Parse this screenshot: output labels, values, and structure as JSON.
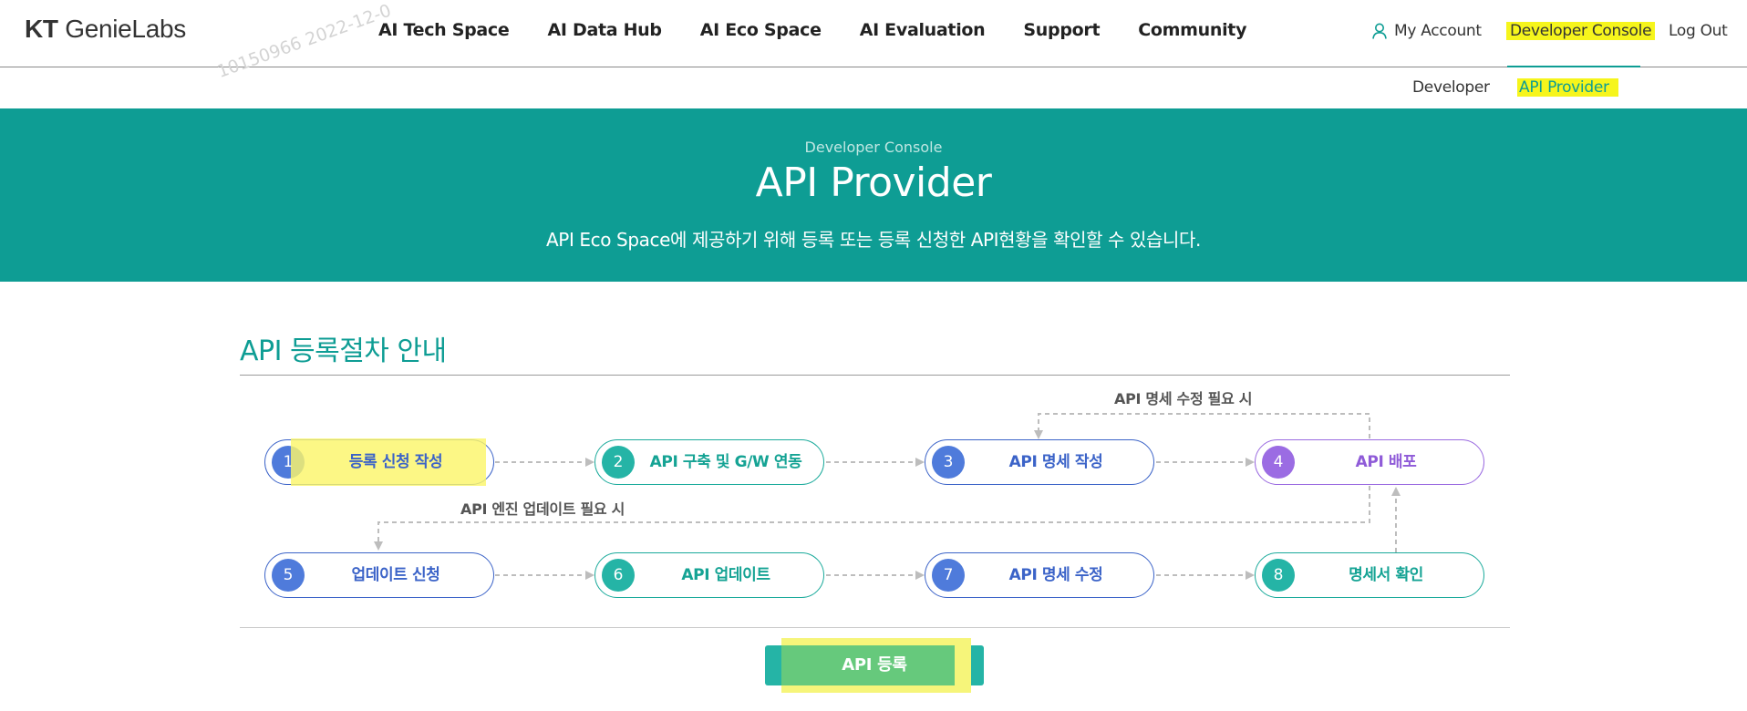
{
  "header": {
    "logo_brand": "KT",
    "logo_name": "GenieLabs",
    "nav": [
      "AI Tech Space",
      "AI Data Hub",
      "AI Eco Space",
      "AI Evaluation",
      "Support",
      "Community"
    ],
    "my_account": "My Account",
    "developer_console": "Developer Console",
    "log_out": "Log Out",
    "icons": {
      "account": "user-icon"
    }
  },
  "subnav": {
    "developer": "Developer",
    "api_provider": "API Provider"
  },
  "watermark": "10150966  2022-12-0",
  "banner": {
    "eyebrow": "Developer Console",
    "title": "API Provider",
    "description": "API Eco Space에 제공하기 위해 등록 또는 등록 신청한 API현황을 확인할 수 있습니다."
  },
  "section": {
    "title": "API 등록절차 안내",
    "note_spec_change": "API 명세 수정 필요 시",
    "note_engine_update": "API 엔진 업데이트 필요 시",
    "steps": [
      {
        "num": "1",
        "label": "등록 신청 작성"
      },
      {
        "num": "2",
        "label": "API 구축 및 G/W 연동"
      },
      {
        "num": "3",
        "label": "API 명세 작성"
      },
      {
        "num": "4",
        "label": "API 배포"
      },
      {
        "num": "5",
        "label": "업데이트 신청"
      },
      {
        "num": "6",
        "label": "API 업데이트"
      },
      {
        "num": "7",
        "label": "API 명세 수정"
      },
      {
        "num": "8",
        "label": "명세서 확인"
      }
    ]
  },
  "register_button": "API 등록",
  "colors": {
    "brand_teal": "#0e9d94",
    "step_blue": "#3b63c8",
    "step_teal": "#1aaa9b",
    "step_purple": "#9a6ae0",
    "highlight": "#f6f51c"
  }
}
